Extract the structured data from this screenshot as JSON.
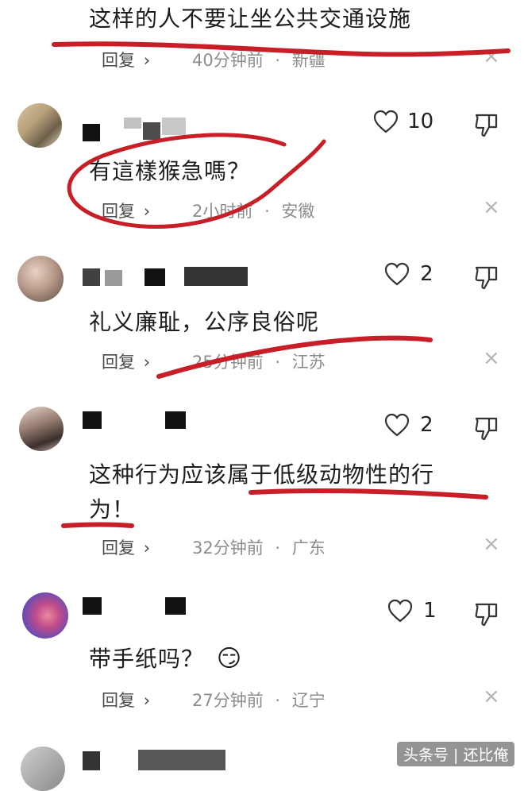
{
  "comments": [
    {
      "text": "这样的人不要让坐公共交通设施",
      "reply_label": "回复",
      "time": "40分钟前",
      "location": "新疆"
    },
    {
      "text": "有這樣猴急嗎？",
      "reply_label": "回复",
      "time": "2小时前",
      "location": "安徽",
      "likes": "10"
    },
    {
      "text": "礼义廉耻，公序良俗呢",
      "reply_label": "回复",
      "time": "25分钟前",
      "location": "江苏",
      "likes": "2"
    },
    {
      "text_line1": "这种行为应该属于低级动物性的行",
      "text_line2": "为！",
      "reply_label": "回复",
      "time": "32分钟前",
      "location": "广东",
      "likes": "2"
    },
    {
      "text": "带手纸吗？",
      "reply_label": "回复",
      "time": "27分钟前",
      "location": "辽宁",
      "likes": "1"
    }
  ],
  "separator": "·",
  "chevron": "›",
  "close_glyph": "×",
  "emoji": "😏",
  "watermark": "头条号 | 还比俺",
  "icons": [
    "heart-outline-icon",
    "thumbs-down-icon",
    "close-icon",
    "chevron-right-icon"
  ],
  "colors": {
    "annotation_red": "#c81e28",
    "meta_gray": "#8c8c8c"
  }
}
